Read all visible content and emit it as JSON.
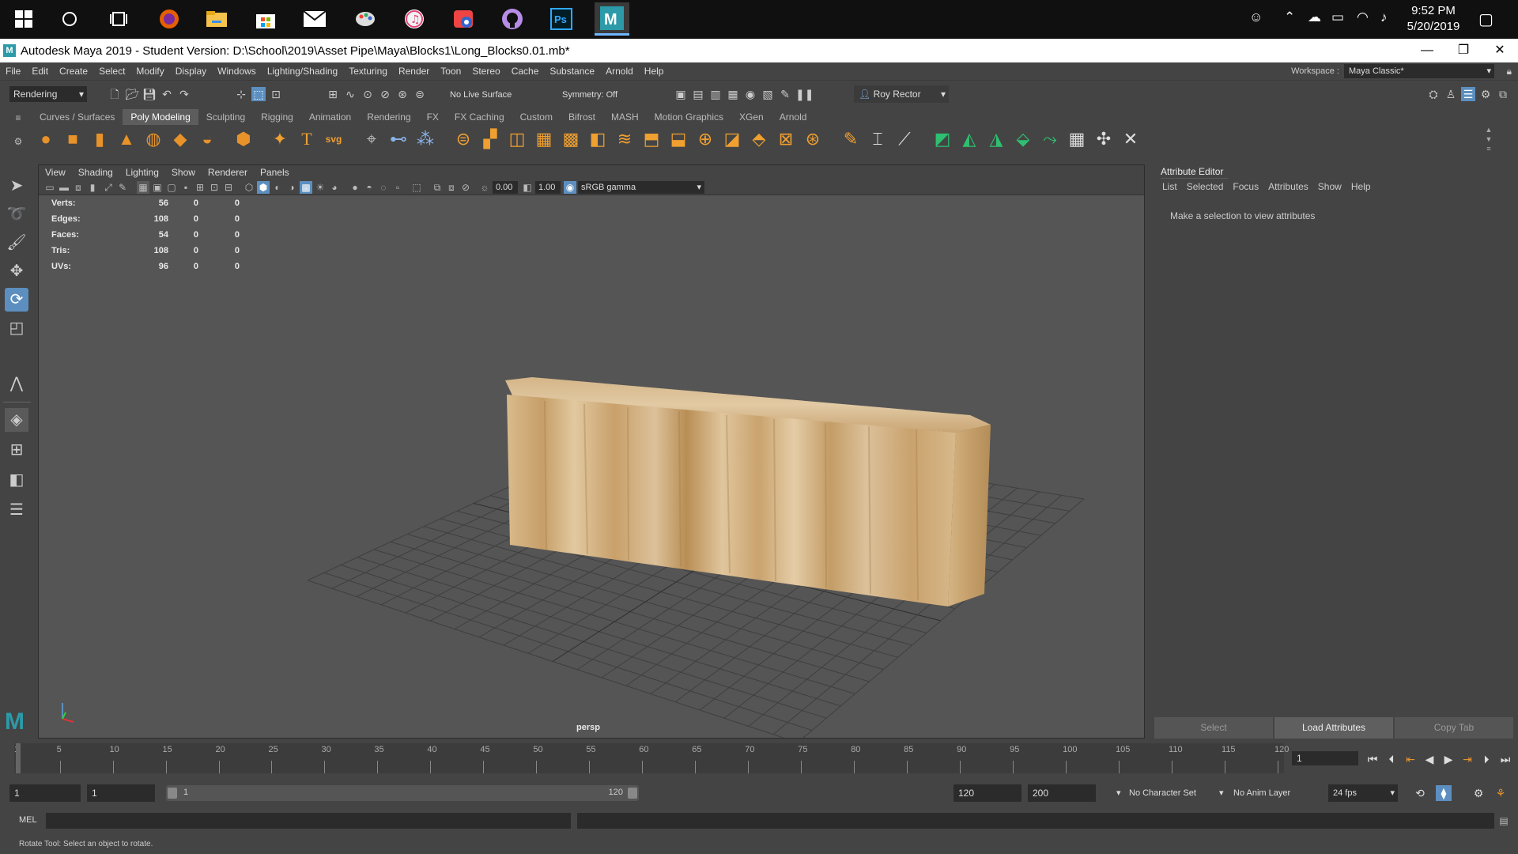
{
  "taskbar": {
    "time": "9:52 PM",
    "date": "5/20/2019"
  },
  "window": {
    "title": "Autodesk Maya 2019 - Student Version: D:\\School\\2019\\Asset Pipe\\Maya\\Blocks1\\Long_Blocks0.01.mb*",
    "app_logo": "M"
  },
  "menus": [
    "File",
    "Edit",
    "Create",
    "Select",
    "Modify",
    "Display",
    "Windows",
    "Lighting/Shading",
    "Texturing",
    "Render",
    "Toon",
    "Stereo",
    "Cache",
    "Substance",
    "Arnold",
    "Help"
  ],
  "workspace": {
    "label": "Workspace :",
    "value": "Maya Classic*"
  },
  "status_line": {
    "menu_set": "Rendering",
    "live_surface": "No Live Surface",
    "symmetry": "Symmetry: Off",
    "user": "Roy Rector"
  },
  "shelf": {
    "tabs": [
      "Curves / Surfaces",
      "Poly Modeling",
      "Sculpting",
      "Rigging",
      "Animation",
      "Rendering",
      "FX",
      "FX Caching",
      "Custom",
      "Bifrost",
      "MASH",
      "Motion Graphics",
      "XGen",
      "Arnold"
    ],
    "active_tab": "Poly Modeling",
    "text_icon": "T",
    "svg_icon": "svg"
  },
  "viewport": {
    "menu": [
      "View",
      "Shading",
      "Lighting",
      "Show",
      "Renderer",
      "Panels"
    ],
    "field_a": "0.00",
    "field_b": "1.00",
    "color_space": "sRGB gamma",
    "camera": "persp",
    "hud": [
      {
        "label": "Verts:",
        "values": [
          "56",
          "0",
          "0"
        ]
      },
      {
        "label": "Edges:",
        "values": [
          "108",
          "0",
          "0"
        ]
      },
      {
        "label": "Faces:",
        "values": [
          "54",
          "0",
          "0"
        ]
      },
      {
        "label": "Tris:",
        "values": [
          "108",
          "0",
          "0"
        ]
      },
      {
        "label": "UVs:",
        "values": [
          "96",
          "0",
          "0"
        ]
      }
    ]
  },
  "attribute_editor": {
    "title": "Attribute Editor",
    "menu": [
      "List",
      "Selected",
      "Focus",
      "Attributes",
      "Show",
      "Help"
    ],
    "message": "Make a selection to view attributes",
    "buttons": [
      "Select",
      "Load Attributes",
      "Copy Tab"
    ]
  },
  "timeline": {
    "ticks": [
      "1",
      "5",
      "10",
      "15",
      "20",
      "25",
      "30",
      "35",
      "40",
      "45",
      "50",
      "55",
      "60",
      "65",
      "70",
      "75",
      "80",
      "85",
      "90",
      "95",
      "100",
      "105",
      "110",
      "115",
      "120"
    ],
    "current_frame": "1"
  },
  "range": {
    "start": "1",
    "playback_start": "1",
    "slider_start": "1",
    "slider_end": "120",
    "playback_end": "120",
    "end": "200",
    "character_set": "No Character Set",
    "anim_layer": "No Anim Layer",
    "fps": "24 fps"
  },
  "command_line": {
    "label": "MEL"
  },
  "help_line": "Rotate Tool: Select an object to rotate.",
  "colors": {
    "accent": "#5c8fbf",
    "maya_logo": "#2c9aa8",
    "wood_light": "#e3c9a0",
    "wood_dark": "#b88a52"
  }
}
